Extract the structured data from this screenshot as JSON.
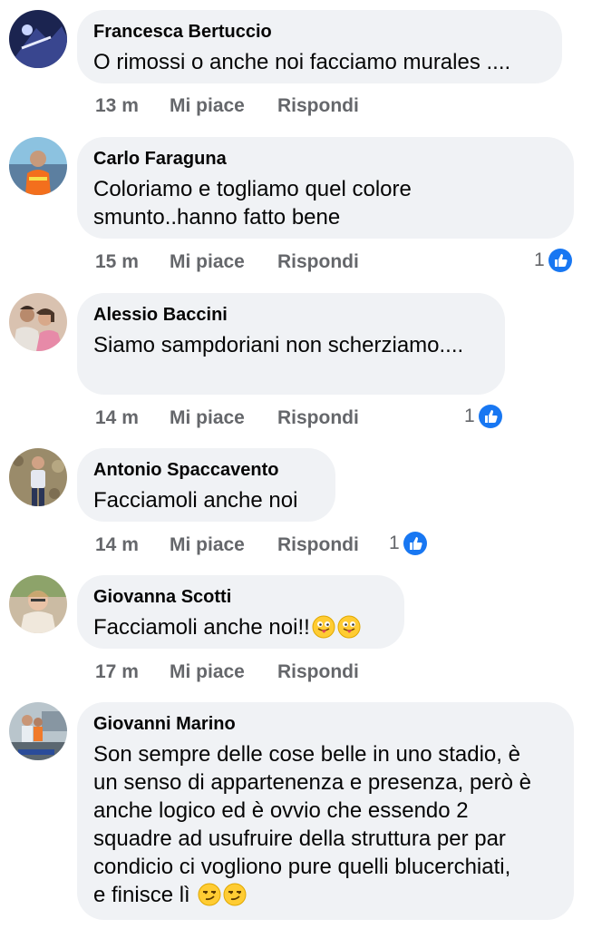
{
  "comments": [
    {
      "author": "Francesca Bertuccio",
      "text": "O rimossi o anche noi facciamo murales ....",
      "time": "13 m",
      "like": "Mi piace",
      "reply": "Rispondi",
      "reactions": null,
      "avatar": "avatar-icon"
    },
    {
      "author": "Carlo Faraguna",
      "text": "Coloriamo e togliamo quel colore\nsmunto..hanno fatto bene",
      "time": "15 m",
      "like": "Mi piace",
      "reply": "Rispondi",
      "reactions": "1",
      "avatar": "avatar-icon"
    },
    {
      "author": "Alessio Baccini",
      "text": "Siamo sampdoriani non scherziamo....",
      "time": "14 m",
      "like": "Mi piace",
      "reply": "Rispondi",
      "reactions": "1",
      "avatar": "avatar-icon"
    },
    {
      "author": "Antonio Spaccavento",
      "text": "Facciamoli anche noi",
      "time": "14 m",
      "like": "Mi piace",
      "reply": "Rispondi",
      "reactions": "1",
      "avatar": "avatar-icon"
    },
    {
      "author": "Giovanna Scotti",
      "text": "Facciamoli anche noi!!",
      "emoji": [
        "tongue-out-emoji",
        "tongue-out-emoji"
      ],
      "time": "17 m",
      "like": "Mi piace",
      "reply": "Rispondi",
      "reactions": null,
      "avatar": "avatar-icon"
    },
    {
      "author": "Giovanni Marino",
      "text": "Son sempre delle cose belle in uno stadio, è\nun senso di appartenenza e presenza, però è\nanche logico ed è ovvio che essendo 2\nsquadre ad usufruire della struttura per par\ncondicio ci vogliono pure quelli blucerchiati,\ne finisce lì",
      "emoji": [
        "smirk-emoji",
        "smirk-emoji"
      ],
      "avatar": "avatar-icon"
    }
  ],
  "colors": {
    "bubble": "#f0f2f5",
    "meta": "#65676b",
    "like_blue": "#1877f2"
  }
}
